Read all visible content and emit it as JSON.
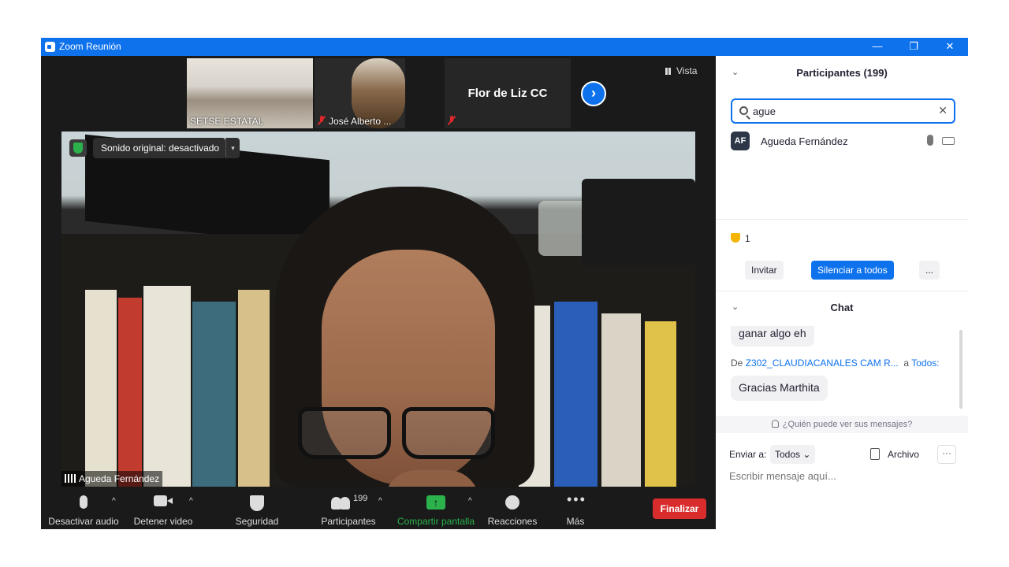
{
  "window": {
    "title": "Zoom Reunión",
    "controls": [
      "—",
      "❐",
      "✕"
    ]
  },
  "gallery": {
    "thumbnails": [
      {
        "name": "SETSE ESTATAL"
      },
      {
        "name": "José Alberto ..."
      },
      {
        "name": ""
      }
    ],
    "big_name": "Flor de Liz CC",
    "next_icon": "›",
    "view_label": "Vista"
  },
  "main_video": {
    "original_sound": "Sonido original: desactivado",
    "caret": "▾",
    "speaker_name": "Agueda Fernández"
  },
  "toolbar": {
    "mute_label": "Desactivar audio",
    "video_label": "Detener video",
    "security_label": "Seguridad",
    "participants_label": "Participantes",
    "participants_count": "199",
    "share_label": "Compartir pantalla",
    "share_icon": "↑",
    "reactions_label": "Reacciones",
    "more_label": "Más",
    "more_icon": "•••",
    "caret": "^",
    "end_label": "Finalizar"
  },
  "participants": {
    "collapse_icon": "⌄",
    "title": "Participantes (199)",
    "search_value": "ague",
    "clear_icon": "✕",
    "results": [
      {
        "initials": "AF",
        "name": "Agueda Fernández"
      }
    ],
    "raised_hands": "1",
    "invite_label": "Invitar",
    "mute_all_label": "Silenciar a todos",
    "more_label": "..."
  },
  "chat": {
    "collapse_icon": "⌄",
    "title": "Chat",
    "messages": [
      {
        "text": "ganar algo eh"
      },
      {
        "text": "Gracias Marthita"
      }
    ],
    "from_prefix": "De",
    "from_sender": "Z302_CLAUDIACANALES CAM R...",
    "to_prefix": "a",
    "to_target": "Todos:",
    "who_can_see": "¿Quién puede ver sus mensajes?",
    "send_to_label": "Enviar a:",
    "send_to_value": "Todos ⌄",
    "file_label": "Archivo",
    "more_icon": "···",
    "input_placeholder": "Escribir mensaje aquí..."
  },
  "colors": {
    "accent": "#0e72ed",
    "end_red": "#d92d2d",
    "share_green": "#2bb24c"
  }
}
